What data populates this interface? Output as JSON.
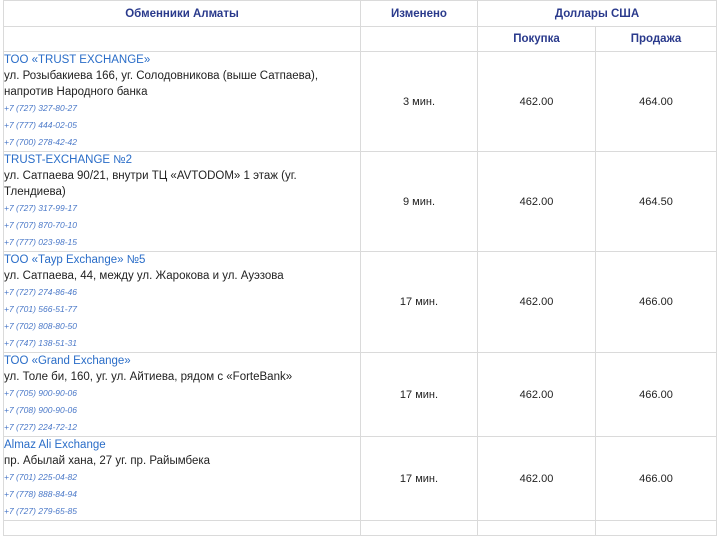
{
  "table": {
    "header": {
      "office": "Обменники Алматы",
      "changed": "Изменено",
      "currency": "Доллары США",
      "buy": "Покупка",
      "sell": "Продажа"
    },
    "rows": [
      {
        "name": "ТОО «TRUST EXCHANGE»",
        "address": "ул. Розыбакиева 166, уг. Солодовникова (выше Сатпаева), напротив Народного банка",
        "phones": [
          "+7 (727) 327-80-27",
          "+7 (777) 444-02-05",
          "+7 (700) 278-42-42"
        ],
        "changed": "3 мин.",
        "buy": "462.00",
        "sell": "464.00"
      },
      {
        "name": "TRUST-EXCHANGE №2",
        "address": "ул. Сатпаева 90/21, внутри ТЦ «AVTODOM» 1 этаж (уг. Тлендиева)",
        "phones": [
          "+7 (727) 317-99-17",
          "+7 (707) 870-70-10",
          "+7 (777) 023-98-15"
        ],
        "changed": "9 мин.",
        "buy": "462.00",
        "sell": "464.50"
      },
      {
        "name": "ТОО «Таур Exchange» №5",
        "address": "ул. Сатпаева, 44, между ул. Жарокова и ул. Ауэзова",
        "phones": [
          "+7 (727) 274-86-46",
          "+7 (701) 566-51-77",
          "+7 (702) 808-80-50",
          "+7 (747) 138-51-31"
        ],
        "changed": "17 мин.",
        "buy": "462.00",
        "sell": "466.00"
      },
      {
        "name": "ТОО «Grand Exchange»",
        "address": "ул. Толе би, 160, уг. ул. Айтиева, рядом с «ForteBank»",
        "phones": [
          "+7 (705) 900-90-06",
          "+7 (708) 900-90-06",
          "+7 (727) 224-72-12"
        ],
        "changed": "17 мин.",
        "buy": "462.00",
        "sell": "466.00"
      },
      {
        "name": "Almaz Ali Exchange",
        "address": "пр. Абылай хана, 27 уг. пр. Райымбека",
        "phones": [
          "+7 (701) 225-04-82",
          "+7 (778) 888-84-94",
          "+7 (727) 279-65-85"
        ],
        "changed": "17 мин.",
        "buy": "462.00",
        "sell": "466.00"
      }
    ]
  }
}
